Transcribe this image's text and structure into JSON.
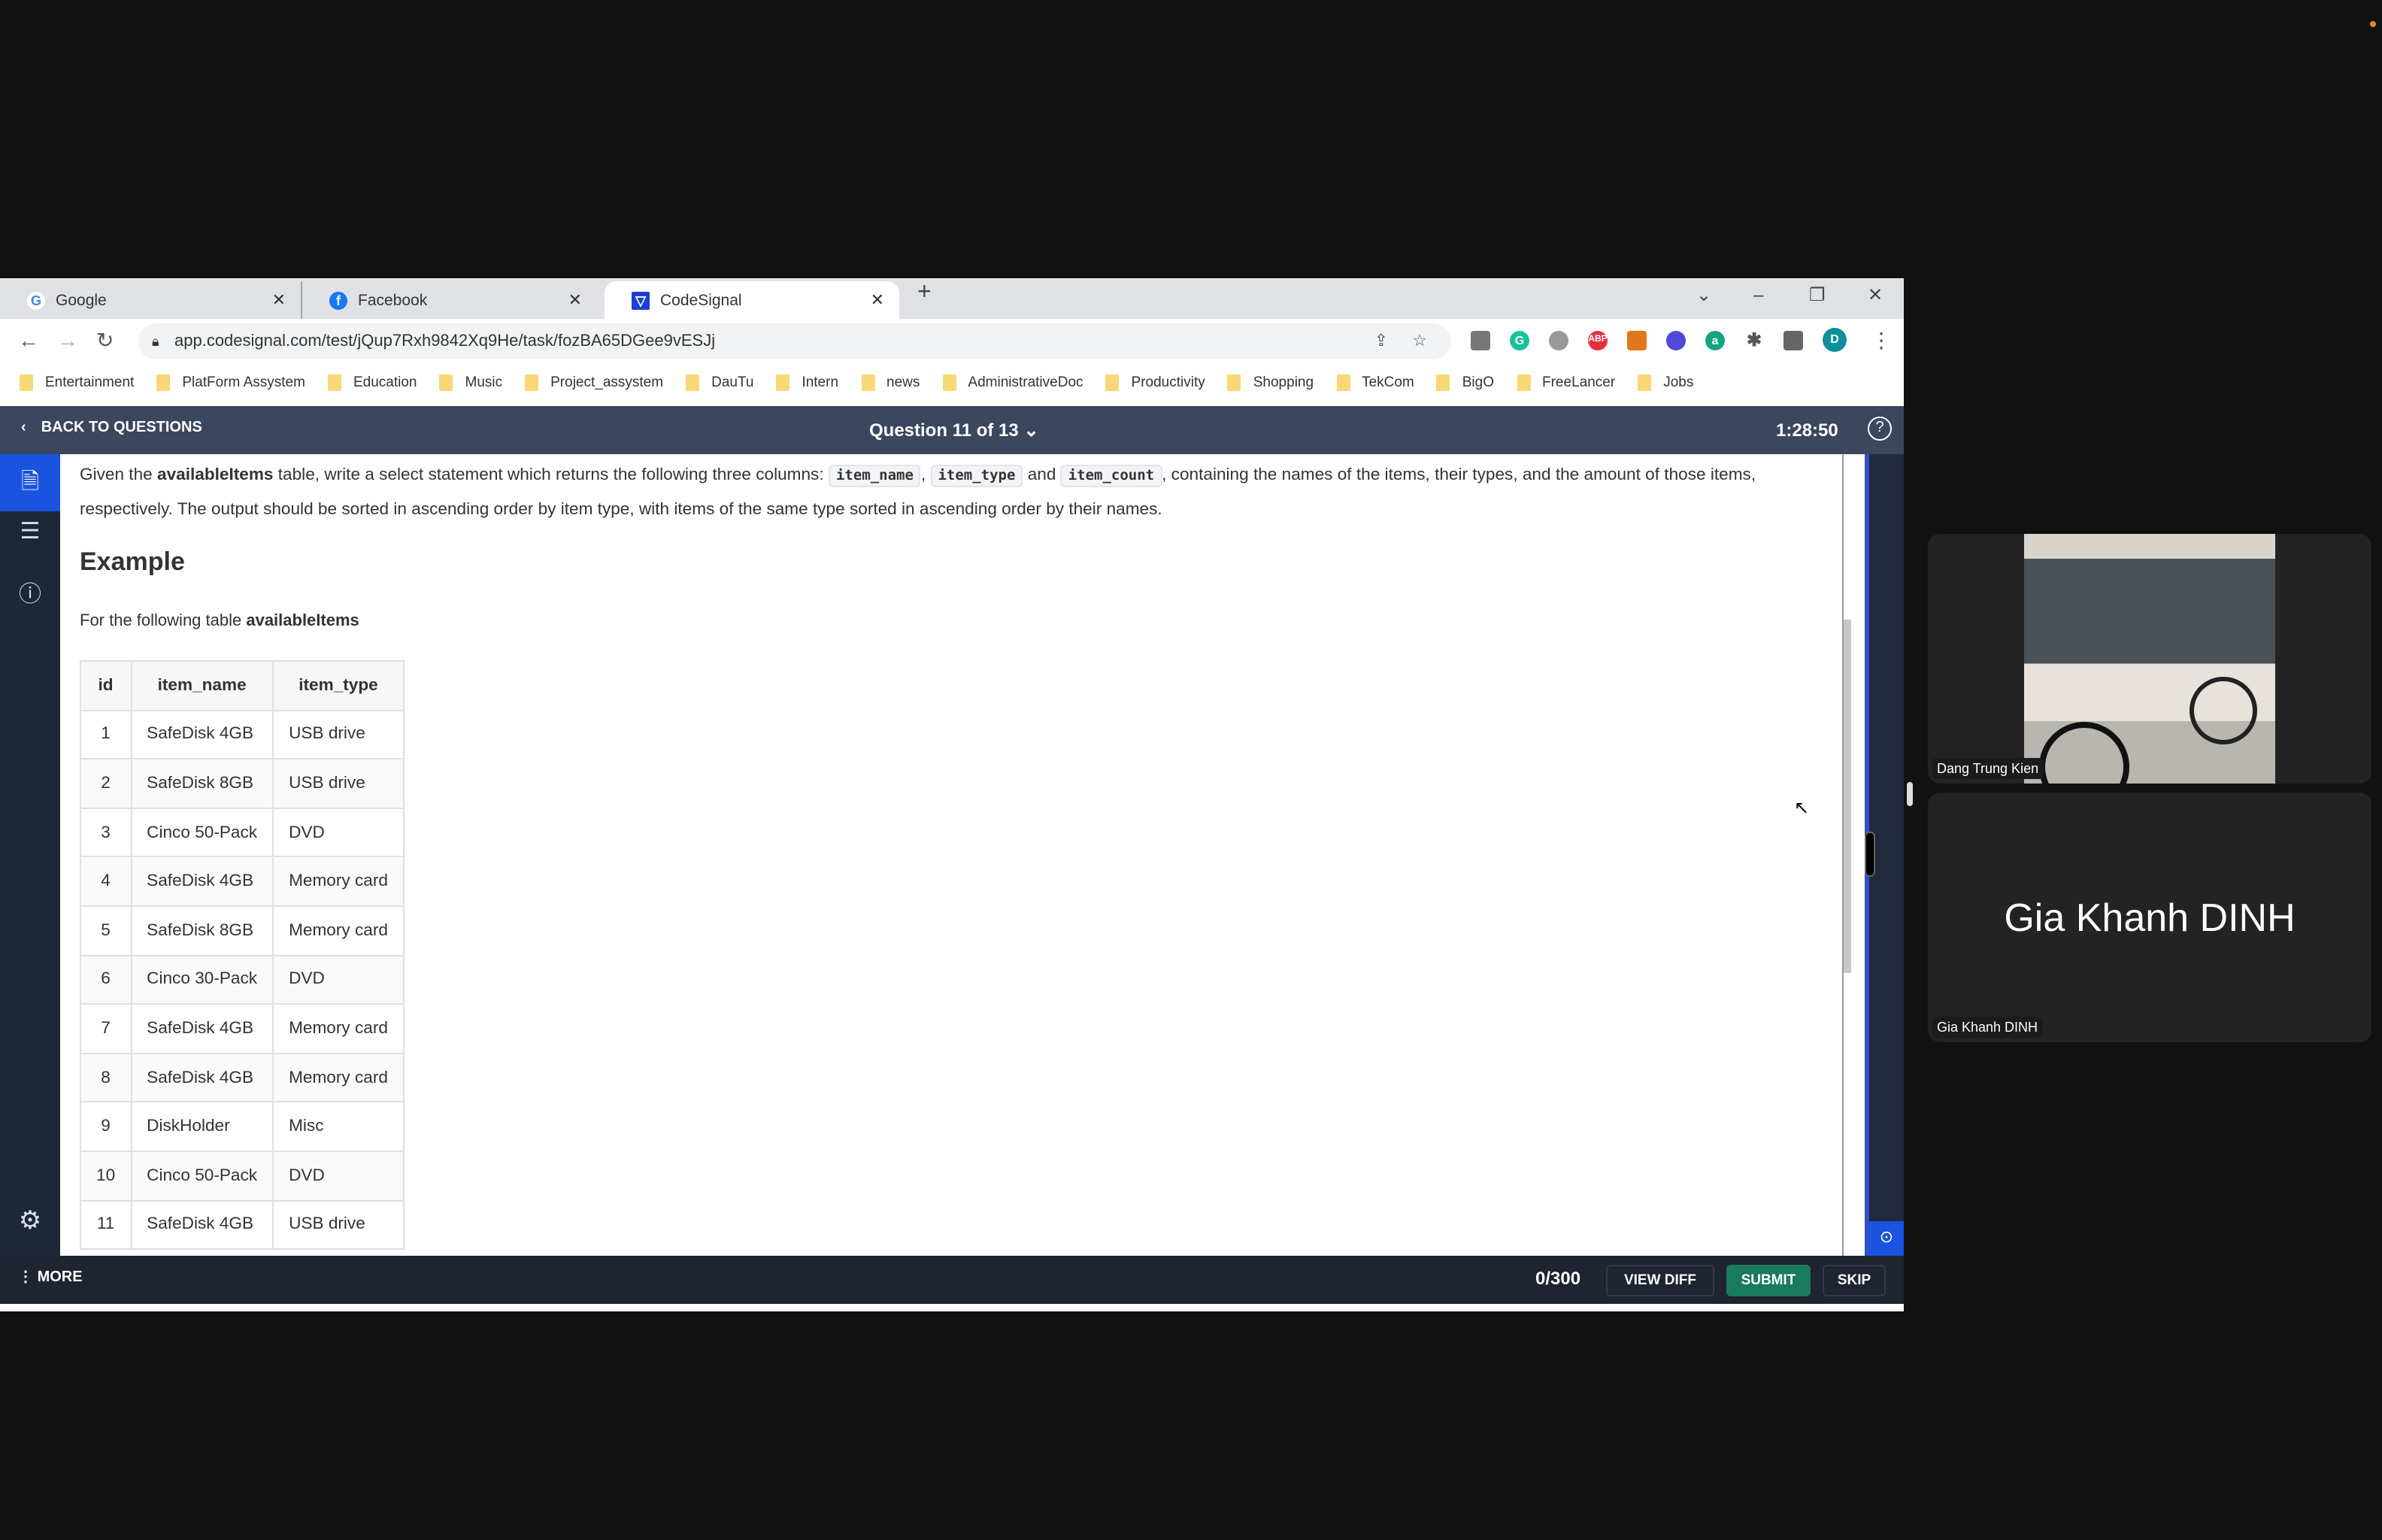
{
  "browser": {
    "tabs": [
      {
        "label": "Google",
        "icon": "google-icon"
      },
      {
        "label": "Facebook",
        "icon": "facebook-icon"
      },
      {
        "label": "CodeSignal",
        "icon": "codesignal-icon",
        "active": true
      }
    ],
    "url": "app.codesignal.com/test/jQup7Rxh9842Xq9He/task/fozBA65DGee9vESJj",
    "profile_initial": "D",
    "extensions": [
      "abp-icon"
    ],
    "extension_abp_label": "ABP",
    "extension_a_label": "a",
    "bookmarks": [
      "Entertainment",
      "PlatForm Assystem",
      "Education",
      "Music",
      "Project_assystem",
      "DauTu",
      "Intern",
      "news",
      "AdministrativeDoc",
      "Productivity",
      "Shopping",
      "TekCom",
      "BigO",
      "FreeLancer",
      "Jobs"
    ]
  },
  "header": {
    "back": "BACK TO QUESTIONS",
    "question": "Question 11 of 13",
    "timer": "1:28:50"
  },
  "task": {
    "p1": "Given the ",
    "table_name": "availableItems",
    "p2": " table, write a select statement which returns the following three columns: ",
    "col1": "item_name",
    "sep1": ", ",
    "col2": "item_type",
    "sep2": " and ",
    "col3": "item_count",
    "p3": ", containing the names of the items, their types, and the amount of those items, respectively. The output should be sorted in ascending order by item type, with items of the same type sorted in ascending order by their names.",
    "example_heading": "Example",
    "example_intro": "For the following table ",
    "example_table": "availableItems",
    "columns": [
      "id",
      "item_name",
      "item_type"
    ],
    "rows": [
      [
        "1",
        "SafeDisk 4GB",
        "USB drive"
      ],
      [
        "2",
        "SafeDisk 8GB",
        "USB drive"
      ],
      [
        "3",
        "Cinco 50-Pack",
        "DVD"
      ],
      [
        "4",
        "SafeDisk 4GB",
        "Memory card"
      ],
      [
        "5",
        "SafeDisk 8GB",
        "Memory card"
      ],
      [
        "6",
        "Cinco 30-Pack",
        "DVD"
      ],
      [
        "7",
        "SafeDisk 4GB",
        "Memory card"
      ],
      [
        "8",
        "SafeDisk 4GB",
        "Memory card"
      ],
      [
        "9",
        "DiskHolder",
        "Misc"
      ],
      [
        "10",
        "Cinco 50-Pack",
        "DVD"
      ],
      [
        "11",
        "SafeDisk 4GB",
        "USB drive"
      ]
    ]
  },
  "footer": {
    "more": "MORE",
    "count": "0/300",
    "view_diff": "VIEW DIFF",
    "submit": "SUBMIT",
    "skip": "SKIP",
    "submit_color": "#1a7a5e"
  },
  "meeting": {
    "participants": [
      {
        "name": "Dang Trung Kien",
        "video": true
      },
      {
        "name": "Gia Khanh DINH",
        "video": false
      }
    ]
  }
}
